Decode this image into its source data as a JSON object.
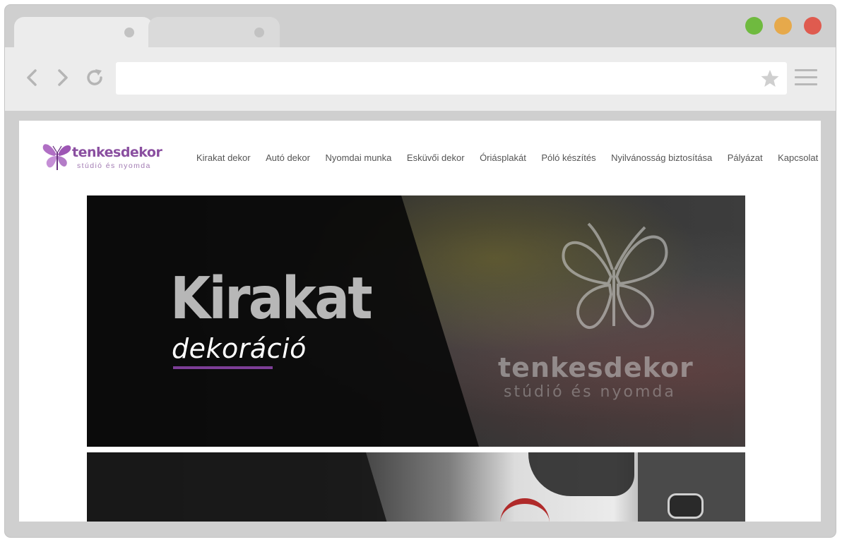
{
  "site": {
    "logo_name": "tenkesdekor",
    "logo_sub": "stúdió és nyomda",
    "nav": [
      "Kirakat dekor",
      "Autó dekor",
      "Nyomdai munka",
      "Esküvői dekor",
      "Óriásplakát",
      "Póló készítés",
      "Nyilvánosság biztosítása",
      "Pályázat",
      "Kapcsolat"
    ]
  },
  "hero": {
    "title": "Kirakat",
    "subtitle": "dekoráció",
    "glass_name": "tenkesdekor",
    "glass_sub": "stúdió és nyomda"
  },
  "colors": {
    "accent": "#7d3e97",
    "logo": "#8a4fa0",
    "window_green": "#6fba3f",
    "window_yellow": "#e6a94b",
    "window_red": "#df5b4f"
  },
  "icons": [
    "back-arrow-icon",
    "forward-arrow-icon",
    "reload-icon",
    "star-icon",
    "hamburger-menu-icon",
    "butterfly-logo-icon"
  ]
}
